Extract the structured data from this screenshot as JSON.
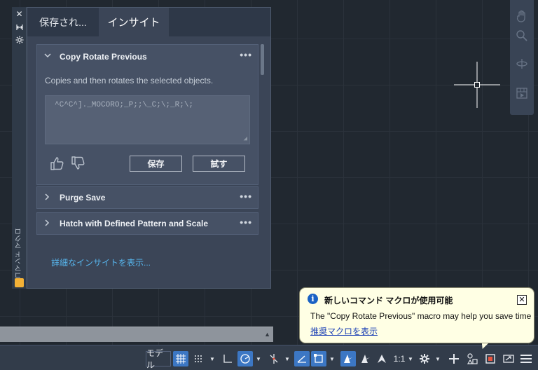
{
  "palette": {
    "close_glyph": "✕",
    "title": "コマンド マクロ"
  },
  "tabs": [
    {
      "label": "保存され..."
    },
    {
      "label": "インサイト"
    }
  ],
  "cards": [
    {
      "title": "Copy Rotate Previous",
      "expanded": true,
      "description": "Copies and then rotates the selected objects.",
      "macro": "^C^C^]._MOCORO;_P;;\\_C;\\;_R;\\;",
      "save_label": "保存",
      "try_label": "試す"
    },
    {
      "title": "Purge Save",
      "expanded": false
    },
    {
      "title": "Hatch with Defined Pattern and Scale",
      "expanded": false
    }
  ],
  "more_glyph": "•••",
  "more_insights_link": "詳細なインサイトを表示...",
  "notification": {
    "title": "新しいコマンド マクロが使用可能",
    "body": "The \"Copy Rotate Previous\" macro may help you save time",
    "link": "推奨マクロを表示",
    "close_glyph": "✕"
  },
  "status_bar": {
    "model_label": "モデル",
    "scale_label": "1:1"
  },
  "colors": {
    "canvas": "#212830",
    "panel": "#3b4557",
    "accent": "#3c77c4",
    "link": "#57b6ee",
    "notification_bg": "#ffffe4"
  }
}
